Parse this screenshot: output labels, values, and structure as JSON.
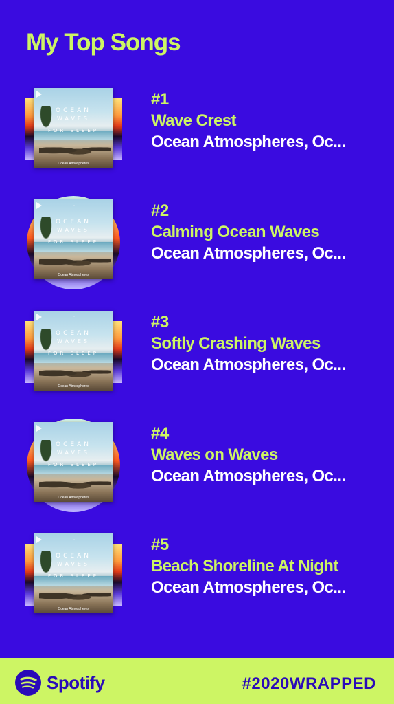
{
  "header": {
    "title": "My Top Songs"
  },
  "songs": [
    {
      "rank": "#1",
      "title": "Wave Crest",
      "artist": "Ocean Atmospheres, Oc...",
      "cover": {
        "line1": "OCEAN",
        "line2": "WAVES",
        "line3": "FOR SLEEP",
        "artist": "Ocean Atmospheres"
      }
    },
    {
      "rank": "#2",
      "title": "Calming Ocean Waves",
      "artist": "Ocean Atmospheres, Oc...",
      "cover": {
        "line1": "OCEAN",
        "line2": "WAVES",
        "line3": "FOR SLEEP",
        "artist": "Ocean Atmospheres"
      }
    },
    {
      "rank": "#3",
      "title": "Softly Crashing Waves",
      "artist": "Ocean Atmospheres, Oc...",
      "cover": {
        "line1": "OCEAN",
        "line2": "WAVES",
        "line3": "FOR SLEEP",
        "artist": "Ocean Atmospheres"
      }
    },
    {
      "rank": "#4",
      "title": "Waves on Waves",
      "artist": "Ocean Atmospheres, Oc...",
      "cover": {
        "line1": "OCEAN",
        "line2": "WAVES",
        "line3": "FOR SLEEP",
        "artist": "Ocean Atmospheres"
      }
    },
    {
      "rank": "#5",
      "title": "Beach Shoreline At Night",
      "artist": "Ocean Atmospheres, Oc...",
      "cover": {
        "line1": "OCEAN",
        "line2": "WAVES",
        "line3": "FOR SLEEP",
        "artist": "Ocean Atmospheres"
      }
    }
  ],
  "footer": {
    "brand": "Spotify",
    "hashtag": "#2020WRAPPED"
  },
  "colors": {
    "background": "#3a0be0",
    "accent": "#cdf564",
    "text": "#ffffff",
    "footer_text": "#2a0bb8"
  },
  "icons": {
    "brand_logo": "spotify-logo-icon"
  }
}
